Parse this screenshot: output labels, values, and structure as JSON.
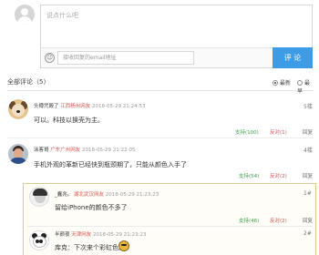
{
  "composer": {
    "placeholder": "说点什么吧",
    "email_placeholder": "接收回复的email地址",
    "submit_label": "评 论",
    "emoji_glyph": "☺"
  },
  "list": {
    "title": "全部评论（5）",
    "sort_latest": "最新",
    "sort_hottest": "最早"
  },
  "comments": [
    {
      "user": "头樽咒毁了",
      "location": "江西杨州网友",
      "time": "2018-05-29 21:24:53",
      "floor": "5楼",
      "text": "可以。科技以换壳为主。",
      "support": "支持(100)",
      "oppose": "反对(1)",
      "reply": "回复"
    },
    {
      "user": "泳客哥",
      "location": "广东广州网友",
      "time": "2018-05-29 21:22:05",
      "floor": "4楼",
      "text": "手机外观的革新已经快到瓶颈期了，只能从颜色入手了",
      "support": "支持(54)",
      "oppose": "反对(2)",
      "reply": "回复"
    }
  ],
  "replies": [
    {
      "user": "_蠢兆。",
      "location": "湖北武汉网友",
      "time": "2018-05-29 21:23:23",
      "floor": "1#",
      "text": "留给iPhone的颜色不多了",
      "support": "支持(46)",
      "oppose": "反对(2)",
      "reply": "回复"
    },
    {
      "user": "半颜夜",
      "location": "天津网友",
      "time": "2018-05-29 21:23:23",
      "floor": "2#",
      "text": "库克：下次来个彩虹色。"
    }
  ]
}
